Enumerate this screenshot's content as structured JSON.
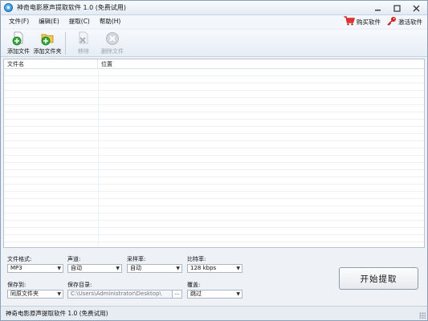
{
  "window": {
    "title": "神奇电影原声提取软件 1.0 (免费试用)"
  },
  "menu": {
    "items": [
      "文件(F)",
      "编辑(E)",
      "提取(C)",
      "帮助(H)"
    ],
    "buy_label": "购买软件",
    "activate_label": "激活软件"
  },
  "toolbar": {
    "add_file": "添加文件",
    "add_folder": "添加文件夹",
    "remove": "移除",
    "delete_file": "删除文件"
  },
  "list": {
    "columns": [
      "文件名",
      "位置"
    ]
  },
  "settings": {
    "format": {
      "label": "文件格式:",
      "value": "MP3"
    },
    "channel": {
      "label": "声道:",
      "value": "自动"
    },
    "sample_rate": {
      "label": "采样率:",
      "value": "自动"
    },
    "bitrate": {
      "label": "比特率:",
      "value": "128 kbps"
    },
    "save_to": {
      "label": "保存到:",
      "value": "同原文件夹"
    },
    "save_dir": {
      "label": "保存目录:",
      "value": "C:\\Users\\Administrator\\Desktop\\",
      "browse": "..."
    },
    "overwrite": {
      "label": "覆盖:",
      "value": "跳过"
    },
    "start_button": "开始提取"
  },
  "status": {
    "text": "神奇电影原声提取软件 1.0 (免费试用)"
  },
  "colors": {
    "accent": "#1b7fd0",
    "list_stripe": "#eef2f6",
    "green_plus": "#2a9d2a"
  }
}
